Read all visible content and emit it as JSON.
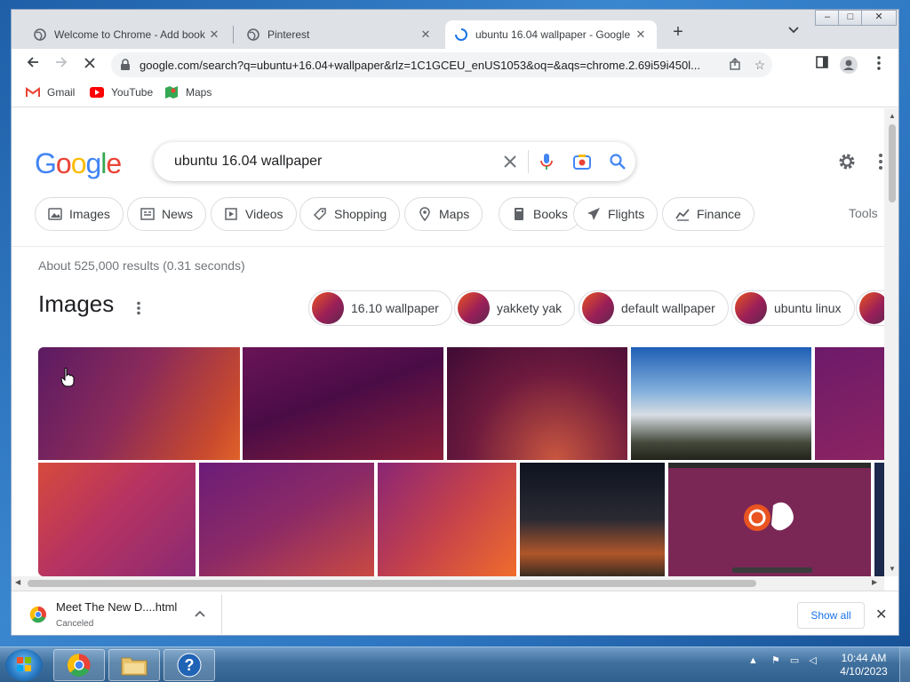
{
  "window": {
    "tabs": [
      {
        "title": "Welcome to Chrome - Add book",
        "favicon": "globe-icon",
        "active": false
      },
      {
        "title": "Pinterest",
        "favicon": "globe-icon",
        "active": false
      },
      {
        "title": "ubuntu 16.04 wallpaper - Google",
        "favicon": "loading-spinner-icon",
        "active": true
      }
    ],
    "new_tab_label": "+",
    "controls": {
      "minimize": "–",
      "maximize": "□",
      "close": "✕"
    }
  },
  "toolbar": {
    "url": "google.com/search?q=ubuntu+16.04+wallpaper&rlz=1C1GCEU_enUS1053&oq=&aqs=chrome.2.69i59i450l..."
  },
  "bookmarks": [
    {
      "label": "Gmail",
      "icon": "gmail-icon"
    },
    {
      "label": "YouTube",
      "icon": "youtube-icon"
    },
    {
      "label": "Maps",
      "icon": "maps-icon"
    }
  ],
  "google": {
    "logo": [
      "G",
      "o",
      "o",
      "g",
      "l",
      "e"
    ],
    "query": "ubuntu 16.04 wallpaper",
    "chips": [
      {
        "label": "Images",
        "icon": "image-icon"
      },
      {
        "label": "News",
        "icon": "news-icon"
      },
      {
        "label": "Videos",
        "icon": "video-icon"
      },
      {
        "label": "Shopping",
        "icon": "tag-icon"
      },
      {
        "label": "Maps",
        "icon": "pin-icon"
      },
      {
        "label": "Books",
        "icon": "book-icon"
      },
      {
        "label": "Flights",
        "icon": "plane-icon"
      },
      {
        "label": "Finance",
        "icon": "finance-icon"
      }
    ],
    "tools_label": "Tools",
    "stats": "About 525,000 results (0.31 seconds)",
    "images_title": "Images",
    "related": [
      "16.10 wallpaper",
      "yakkety yak",
      "default wallpaper",
      "ubuntu linux"
    ]
  },
  "download": {
    "filename": "Meet The New D....html",
    "status": "Canceled",
    "show_all": "Show all"
  },
  "taskbar": {
    "time": "10:44 AM",
    "date": "4/10/2023"
  },
  "colors": {
    "google_blue": "#4285F4",
    "google_red": "#EA4335",
    "google_yellow": "#FBBC05",
    "google_green": "#34A853",
    "ubuntu_orange": "#E95420",
    "ubuntu_purple": "#5E2750"
  }
}
